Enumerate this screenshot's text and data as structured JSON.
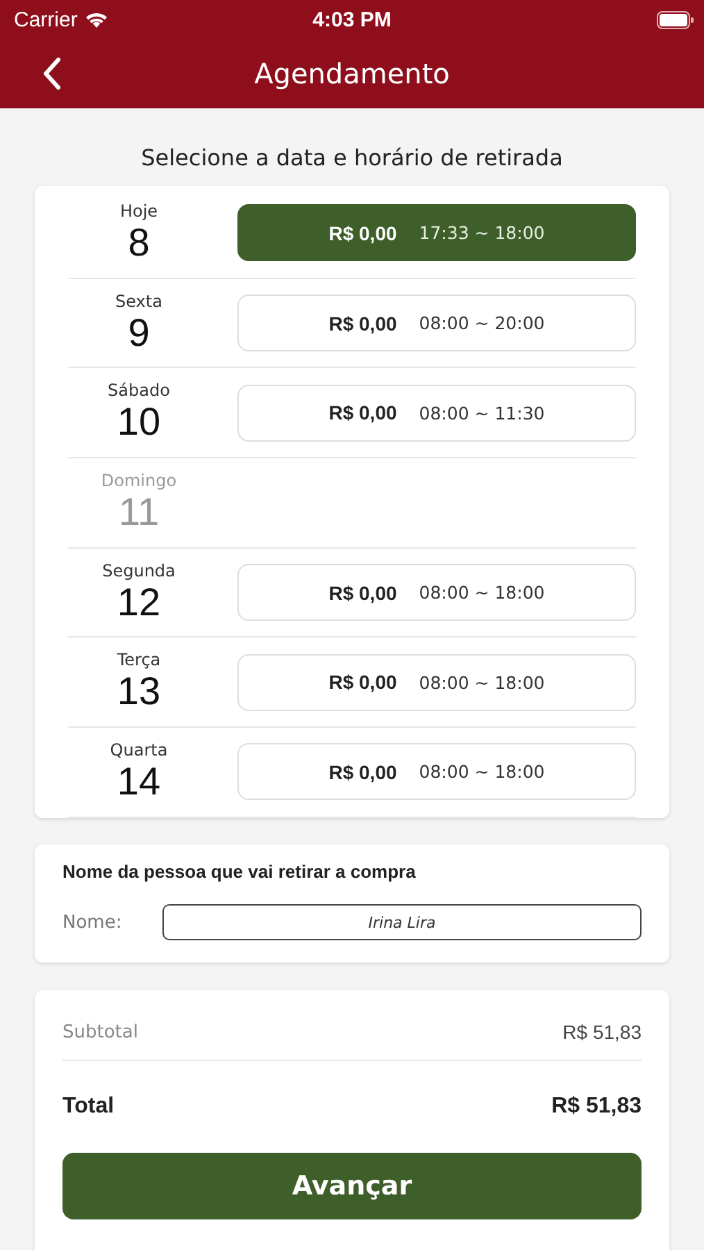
{
  "status_bar": {
    "carrier": "Carrier",
    "time": "4:03 PM"
  },
  "nav": {
    "title": "Agendamento"
  },
  "heading": "Selecione a data e horário de retirada",
  "days": [
    {
      "weekday": "Hoje",
      "day": "8",
      "disabled": false,
      "slot": {
        "price": "R$ 0,00",
        "hours": "17:33 ~ 18:00",
        "selected": true
      }
    },
    {
      "weekday": "Sexta",
      "day": "9",
      "disabled": false,
      "slot": {
        "price": "R$ 0,00",
        "hours": "08:00 ~ 20:00",
        "selected": false
      }
    },
    {
      "weekday": "Sábado",
      "day": "10",
      "disabled": false,
      "slot": {
        "price": "R$ 0,00",
        "hours": "08:00 ~ 11:30",
        "selected": false
      }
    },
    {
      "weekday": "Domingo",
      "day": "11",
      "disabled": true
    },
    {
      "weekday": "Segunda",
      "day": "12",
      "disabled": false,
      "slot": {
        "price": "R$ 0,00",
        "hours": "08:00 ~ 18:00",
        "selected": false
      }
    },
    {
      "weekday": "Terça",
      "day": "13",
      "disabled": false,
      "slot": {
        "price": "R$ 0,00",
        "hours": "08:00 ~ 18:00",
        "selected": false
      }
    },
    {
      "weekday": "Quarta",
      "day": "14",
      "disabled": false,
      "slot": {
        "price": "R$ 0,00",
        "hours": "08:00 ~ 18:00",
        "selected": false
      }
    }
  ],
  "pickup": {
    "title": "Nome da pessoa que vai retirar a compra",
    "label": "Nome:",
    "value": "Irina Lira"
  },
  "summary": {
    "subtotal_label": "Subtotal",
    "subtotal": "R$ 51,83",
    "total_label": "Total",
    "total": "R$ 51,83"
  },
  "button": "Avançar"
}
